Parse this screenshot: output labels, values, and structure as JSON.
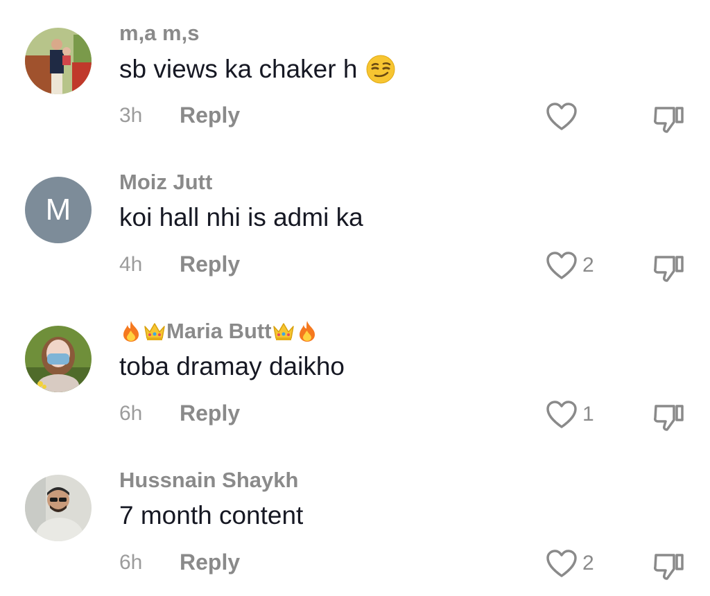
{
  "comments": [
    {
      "username": "m,a m,s",
      "text": "sb views ka chaker h",
      "text_emoji": "smirk-emoji",
      "time": "3h",
      "reply_label": "Reply",
      "likes": "",
      "avatar": "photo-man-with-child"
    },
    {
      "username": "Moiz Jutt",
      "text": "koi hall nhi is admi ka",
      "time": "4h",
      "reply_label": "Reply",
      "likes": "2",
      "avatar_letter": "M",
      "avatar_color": "#7d8c99"
    },
    {
      "username": "Maria Butt",
      "username_decorations": [
        "fire-emoji",
        "crown-emoji"
      ],
      "text": "toba dramay daikho",
      "time": "6h",
      "reply_label": "Reply",
      "likes": "1",
      "avatar": "photo-woman-with-mask"
    },
    {
      "username": "Hussnain Shaykh",
      "text": "7 month content",
      "time": "6h",
      "reply_label": "Reply",
      "likes": "2",
      "avatar": "photo-man-with-sunglasses"
    }
  ],
  "icons": {
    "like": "heart-outline-icon",
    "dislike": "thumbs-down-outline-icon"
  },
  "colors": {
    "username": "#8a8a8a",
    "text": "#161823",
    "meta": "#9b9b9b",
    "icon": "#8a8a8a"
  }
}
